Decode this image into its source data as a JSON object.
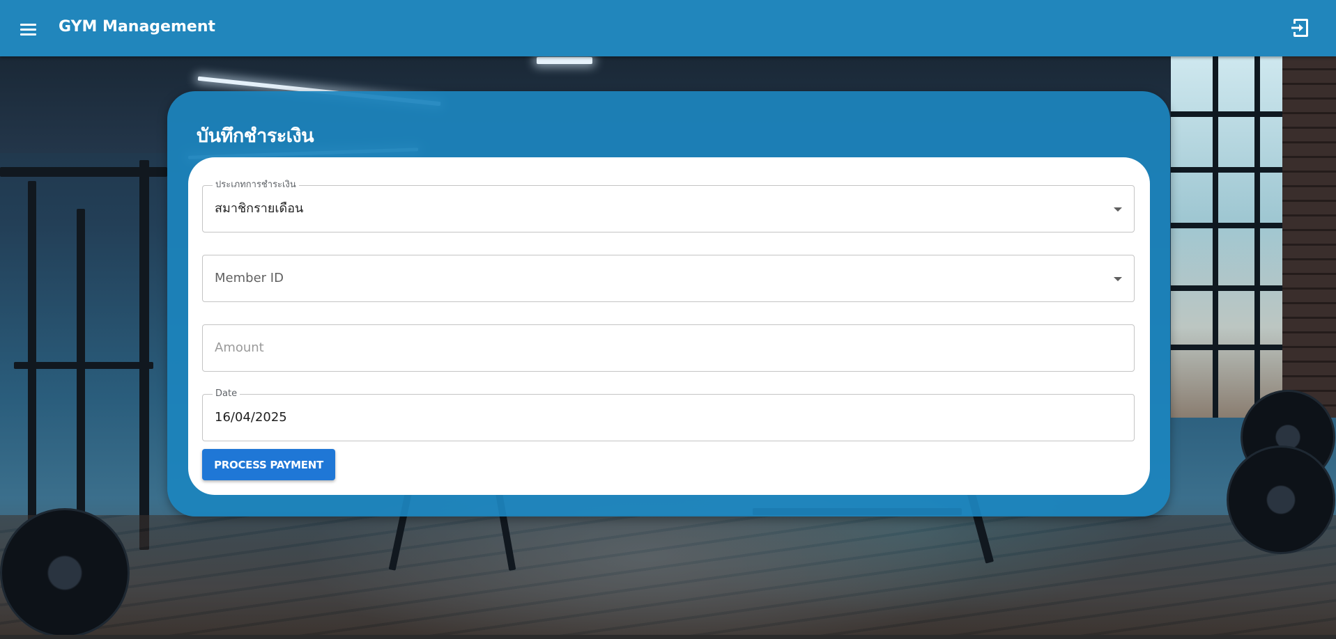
{
  "appbar": {
    "title": "GYM Management",
    "menu_icon": "menu-icon",
    "logout_icon": "logout-icon",
    "background_color": "#2186bc"
  },
  "card": {
    "title": "บันทึกชำระเงิน",
    "background_color": "#1c84bd"
  },
  "form": {
    "payment_type": {
      "label": "ประเภทการชำระเงิน",
      "value": "สมาชิกรายเดือน"
    },
    "member_id": {
      "placeholder": "Member ID"
    },
    "amount": {
      "placeholder": "Amount"
    },
    "date": {
      "label": "Date",
      "value": "16/04/2025"
    },
    "submit_label": "PROCESS PAYMENT",
    "submit_color": "#1f77d6"
  }
}
